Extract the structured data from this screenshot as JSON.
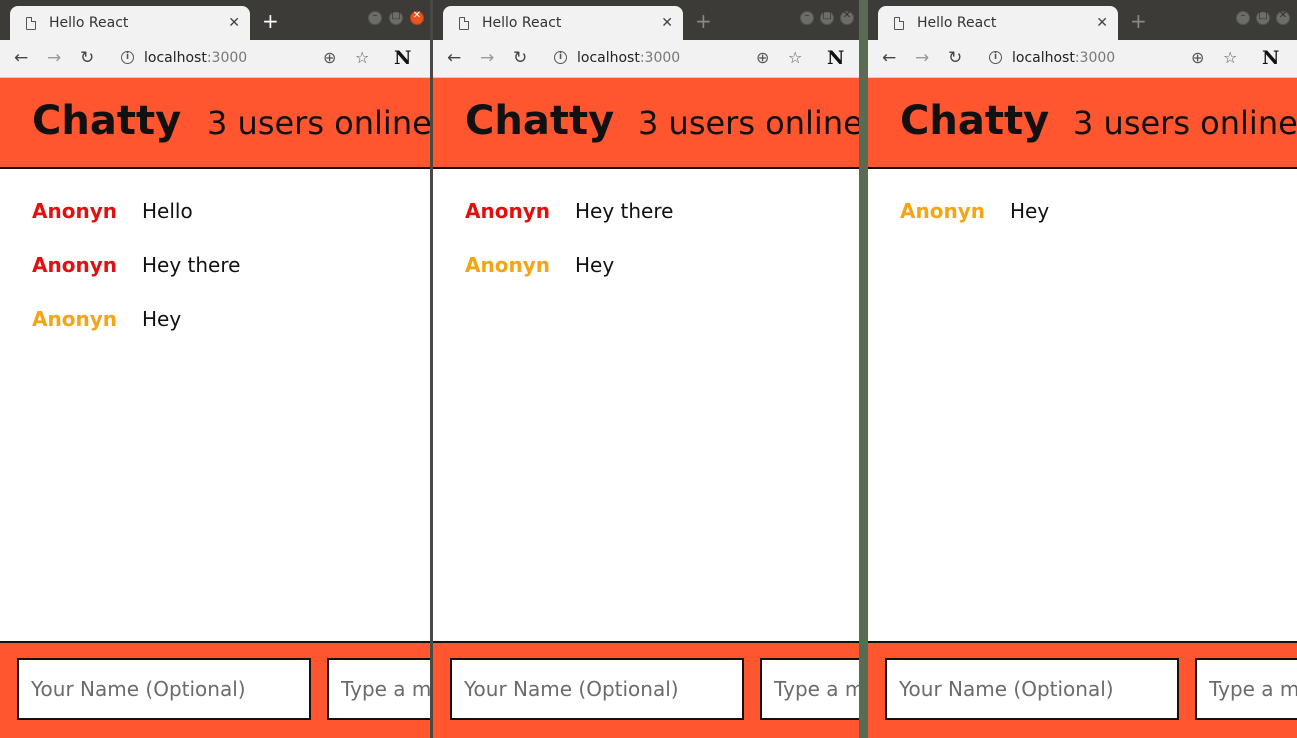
{
  "colors": {
    "header": "#ff5630",
    "user_red": "#e11111",
    "user_orange": "#f5a513"
  },
  "windows": [
    {
      "tab_title": "Hello React",
      "url_host": "localhost",
      "url_port": ":3000",
      "brand": "Chatty",
      "users_online": "3 users online",
      "messages": [
        {
          "username": "Anonyn",
          "content": "Hello",
          "color": "#e11111"
        },
        {
          "username": "Anonyn",
          "content": "Hey there",
          "color": "#e11111"
        },
        {
          "username": "Anonyn",
          "content": "Hey",
          "color": "#f5a513"
        }
      ],
      "name_placeholder": "Your Name (Optional)",
      "message_placeholder": "Type a m"
    },
    {
      "tab_title": "Hello React",
      "url_host": "localhost",
      "url_port": ":3000",
      "brand": "Chatty",
      "users_online": "3 users online",
      "messages": [
        {
          "username": "Anonyn",
          "content": "Hey there",
          "color": "#e11111"
        },
        {
          "username": "Anonyn",
          "content": "Hey",
          "color": "#f5a513"
        }
      ],
      "name_placeholder": "Your Name (Optional)",
      "message_placeholder": "Type a m"
    },
    {
      "tab_title": "Hello React",
      "url_host": "localhost",
      "url_port": ":3000",
      "brand": "Chatty",
      "users_online": "3 users online",
      "messages": [
        {
          "username": "Anonyn",
          "content": "Hey",
          "color": "#f5a513"
        }
      ],
      "name_placeholder": "Your Name (Optional)",
      "message_placeholder": "Type a m"
    }
  ]
}
